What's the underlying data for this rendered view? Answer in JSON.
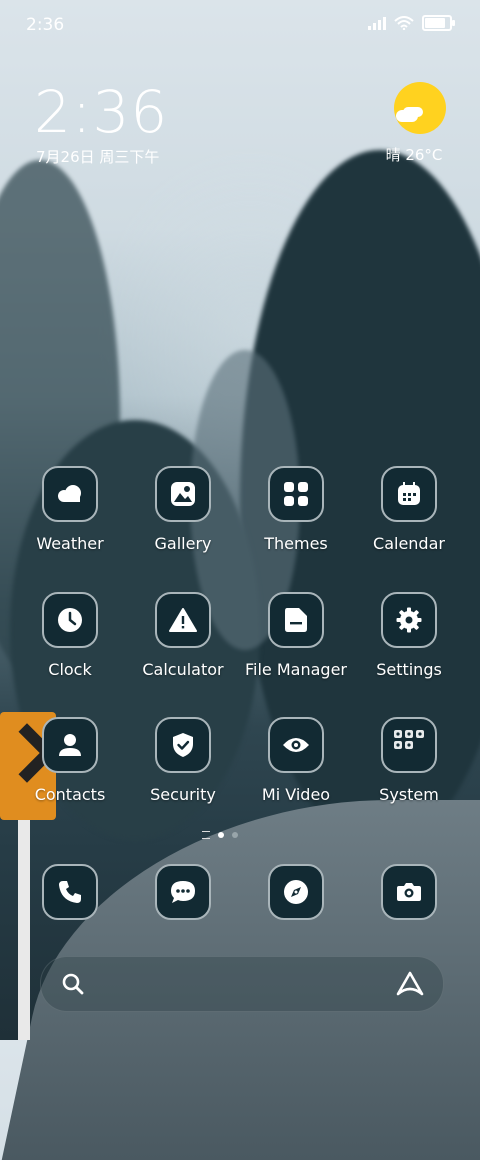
{
  "status_bar": {
    "time": "2:36"
  },
  "clock_widget": {
    "time": "2:36",
    "date": "7月26日 周三下午"
  },
  "weather_widget": {
    "text": "晴 26°C"
  },
  "apps": [
    {
      "label": "Weather",
      "icon": "weather-icon"
    },
    {
      "label": "Gallery",
      "icon": "gallery-icon"
    },
    {
      "label": "Themes",
      "icon": "themes-icon"
    },
    {
      "label": "Calendar",
      "icon": "calendar-icon"
    },
    {
      "label": "Clock",
      "icon": "clock-icon"
    },
    {
      "label": "Calculator",
      "icon": "calculator-icon"
    },
    {
      "label": "File Manager",
      "icon": "file-manager-icon"
    },
    {
      "label": "Settings",
      "icon": "settings-icon"
    },
    {
      "label": "Contacts",
      "icon": "contacts-icon"
    },
    {
      "label": "Security",
      "icon": "security-icon"
    },
    {
      "label": "Mi Video",
      "icon": "mi-video-icon"
    },
    {
      "label": "System",
      "icon": "system-folder-icon"
    }
  ],
  "dock": [
    "phone-icon",
    "messages-icon",
    "browser-icon",
    "camera-icon"
  ],
  "colors": {
    "tile_bg": "#122a33",
    "sun": "#ffd21f"
  }
}
